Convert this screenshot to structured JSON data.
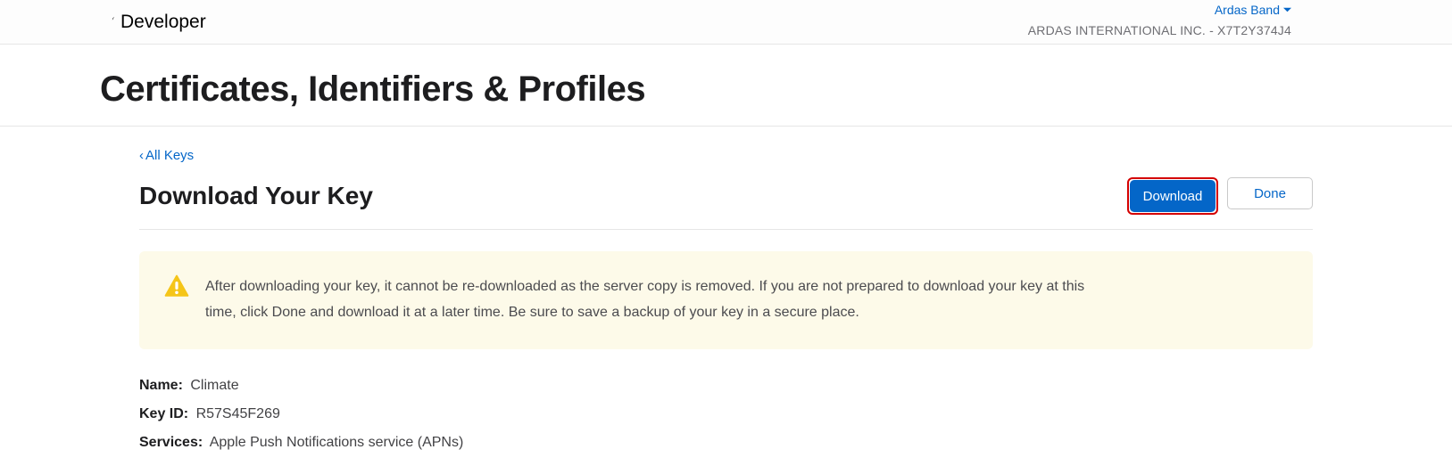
{
  "header": {
    "brand": "Developer",
    "user_name": "Ardas Band",
    "org_line": "ARDAS INTERNATIONAL INC. - X7T2Y374J4"
  },
  "page": {
    "title": "Certificates, Identifiers & Profiles",
    "back_link": "All Keys",
    "sub_title": "Download Your Key",
    "download_label": "Download",
    "done_label": "Done"
  },
  "alert": {
    "text": "After downloading your key, it cannot be re-downloaded as the server copy is removed. If you are not prepared to download your key at this time, click Done and download it at a later time. Be sure to save a backup of your key in a secure place."
  },
  "details": {
    "name_label": "Name:",
    "name_value": "Climate",
    "keyid_label": "Key ID:",
    "keyid_value": "R57S45F269",
    "services_label": "Services:",
    "services_value": "Apple Push Notifications service (APNs)"
  }
}
